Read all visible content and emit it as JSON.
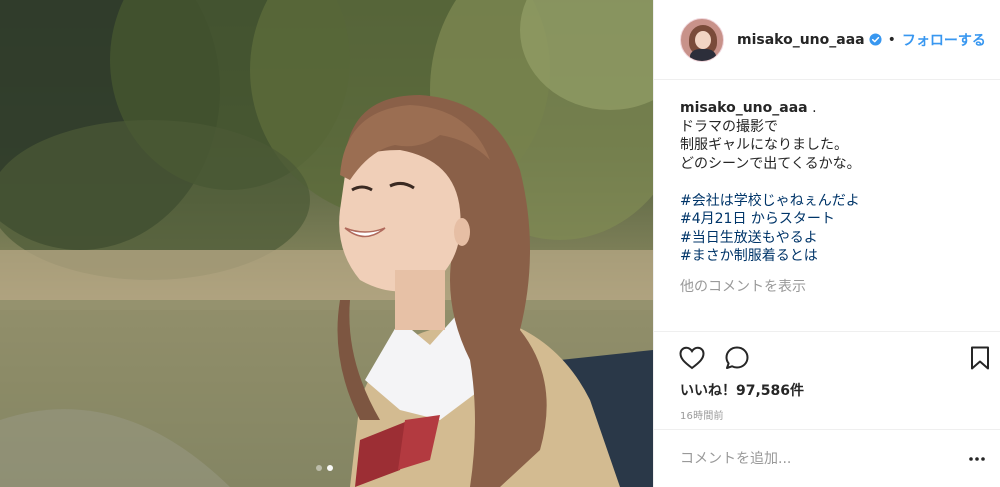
{
  "post": {
    "photo_alt": "",
    "carousel": {
      "count": 2,
      "active": 2
    }
  },
  "header": {
    "username": "misako_uno_aaa",
    "separator": "•",
    "follow_label": "フォローする"
  },
  "caption": {
    "username": "misako_uno_aaa",
    "lead": " .",
    "lines": [
      "ドラマの撮影で",
      "制服ギャルになりました。",
      "どのシーンで出てくるかな。"
    ],
    "hashtags": [
      "#会社は学校じゃねぇんだよ",
      "#4月21日 からスタート",
      "#当日生放送もやるよ",
      "#まさか制服着るとは"
    ]
  },
  "comments": {
    "more_label": "他のコメントを表示"
  },
  "stats": {
    "likes_text": "いいね！97,586件",
    "time_text": "16時間前"
  },
  "comment_box": {
    "placeholder": "コメントを追加..."
  },
  "colors": {
    "link": "#3897f0",
    "hashtag": "#003569",
    "muted": "#999999",
    "text": "#262626",
    "verified": "#3897f0"
  },
  "icons": [
    "heart-icon",
    "comment-icon",
    "bookmark-icon",
    "verified-icon",
    "more-options-icon"
  ]
}
